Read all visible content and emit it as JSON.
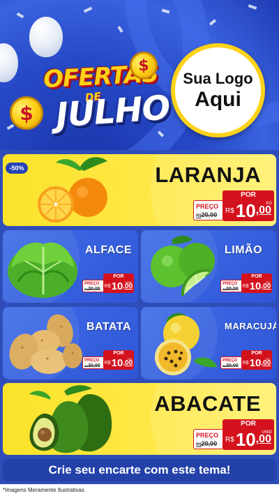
{
  "header": {
    "title_top": "OFERTAS",
    "title_mid": "DE",
    "title_main": "JULHO",
    "coin_symbol": "$",
    "logo_line1": "Sua Logo",
    "logo_line2": "Aqui",
    "colors": {
      "blue": "#2649c7",
      "gold": "#ffd21a",
      "red": "#c1121b"
    }
  },
  "products": [
    {
      "name": "LARANJA",
      "badge": "-50%",
      "por": "POR",
      "preco_label": "PREÇO",
      "old_price": "R$ 20,00",
      "old_prefix": "R$",
      "old_value": "20,00",
      "currency": "R$",
      "price_int": "10",
      "price_cents": ",00",
      "unit": "KG"
    },
    {
      "name": "ALFACE",
      "por": "POR",
      "preco_label": "PREÇO",
      "old_prefix": "R$",
      "old_value": "20,00",
      "currency": "R$",
      "price_int": "10",
      "price_cents": ",00",
      "unit": "UNID"
    },
    {
      "name": "LIMÃO",
      "por": "POR",
      "preco_label": "PREÇO",
      "old_prefix": "R$",
      "old_value": "20,00",
      "currency": "R$",
      "price_int": "10",
      "price_cents": ",00",
      "unit": "KG"
    },
    {
      "name": "BATATA",
      "por": "POR",
      "preco_label": "PREÇO",
      "old_prefix": "R$",
      "old_value": "20,00",
      "currency": "R$",
      "price_int": "10",
      "price_cents": ",00",
      "unit": "KG"
    },
    {
      "name": "MARACUJÁ",
      "por": "POR",
      "preco_label": "PREÇO",
      "old_prefix": "R$",
      "old_value": "20,00",
      "currency": "R$",
      "price_int": "10",
      "price_cents": ",00",
      "unit": "KG"
    },
    {
      "name": "ABACATE",
      "por": "POR",
      "preco_label": "PREÇO",
      "old_prefix": "R$",
      "old_value": "20,00",
      "currency": "R$",
      "price_int": "10",
      "price_cents": ",00",
      "unit": "UNID"
    }
  ],
  "footer": {
    "banner": "Crie seu encarte com este tema!",
    "disclaimer": "*Imagens Meramente Ilustrativas"
  },
  "icons": [
    "orange-icon",
    "lettuce-icon",
    "lime-icon",
    "potato-icon",
    "passion-fruit-icon",
    "avocado-icon",
    "balloon-icon",
    "coin-icon"
  ]
}
